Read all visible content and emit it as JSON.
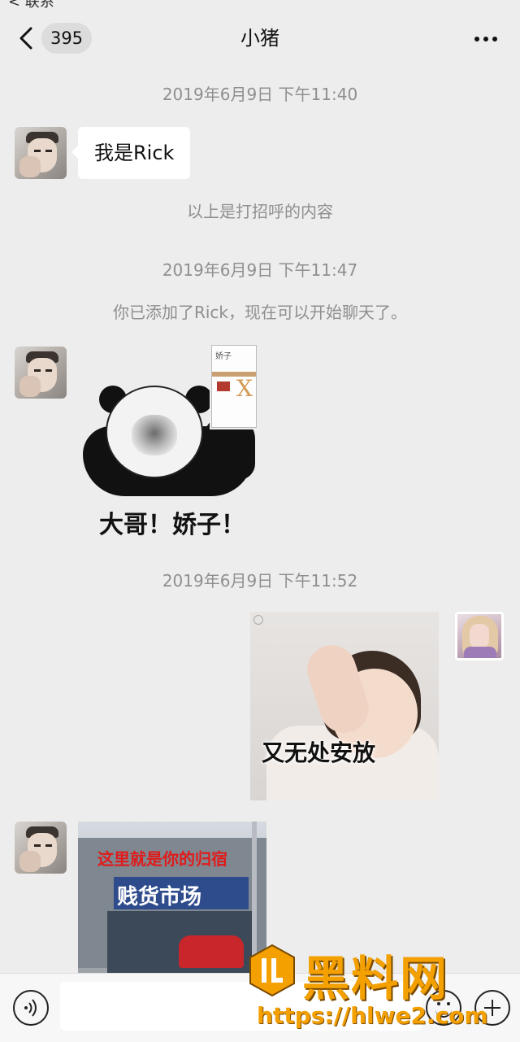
{
  "status_stub": "< 联系",
  "header": {
    "back_label": "<",
    "unread_count": "395",
    "title": "小猪",
    "more_icon": "more-dots-icon"
  },
  "messages": [
    {
      "type": "timestamp",
      "text": "2019年6月9日 下午11:40"
    },
    {
      "type": "text",
      "from": "Rick",
      "text": "我是Rick"
    },
    {
      "type": "system",
      "text": "以上是打招呼的内容"
    },
    {
      "type": "timestamp",
      "text": "2019年6月9日 下午11:47"
    },
    {
      "type": "system",
      "text": "你已添加了Rick，现在可以开始聊天了。"
    },
    {
      "type": "sticker",
      "from": "Rick",
      "pack_text": "娇子",
      "pack_letter": "X",
      "caption": "大哥！娇子！"
    },
    {
      "type": "timestamp",
      "text": "2019年6月9日 下午11:52"
    },
    {
      "type": "sticker",
      "from": "me",
      "caption": "又无处安放"
    },
    {
      "type": "image",
      "from": "Rick",
      "red_text": "这里就是你的归宿",
      "sign_text": "贱货市场"
    }
  ],
  "bottom_bar": {
    "voice_icon": "voice-icon",
    "input_placeholder": "",
    "emoji_icon": "emoji-icon",
    "plus_icon": "plus-icon"
  },
  "watermark": {
    "title": "黑料网",
    "url": "https://hlwe2.com"
  }
}
